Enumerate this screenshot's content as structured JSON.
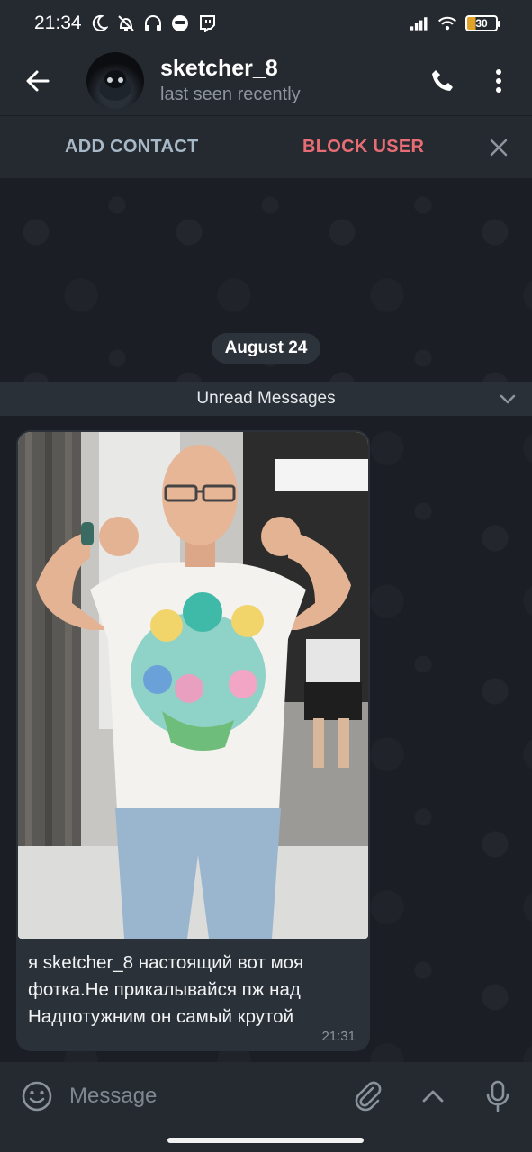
{
  "status_bar": {
    "time": "21:34",
    "icons": [
      "moon-icon",
      "vibrate-off-icon",
      "headset-icon",
      "app-icon",
      "twitch-icon"
    ],
    "right_icons": [
      "signal-icon",
      "wifi-icon"
    ],
    "battery": "30",
    "battery_color": "#e0a32a"
  },
  "header": {
    "title": "sketcher_8",
    "subtitle": "last seen recently"
  },
  "action_bar": {
    "add_contact": "ADD CONTACT",
    "block_user": "BLOCK USER"
  },
  "chat": {
    "date": "August 24",
    "unread_label": "Unread Messages",
    "message": {
      "text": "я sketcher_8 настоящий вот моя\nфотка.Не  прикалывайся пж над\nНадпотужним он самый крутой",
      "time": "21:31"
    }
  },
  "composer": {
    "placeholder": "Message"
  },
  "colors": {
    "accent_block": "#e86c73",
    "accent_add": "#a7b8c6",
    "background": "#1b1f25",
    "bar": "#252a31",
    "bubble": "#2b3138"
  }
}
